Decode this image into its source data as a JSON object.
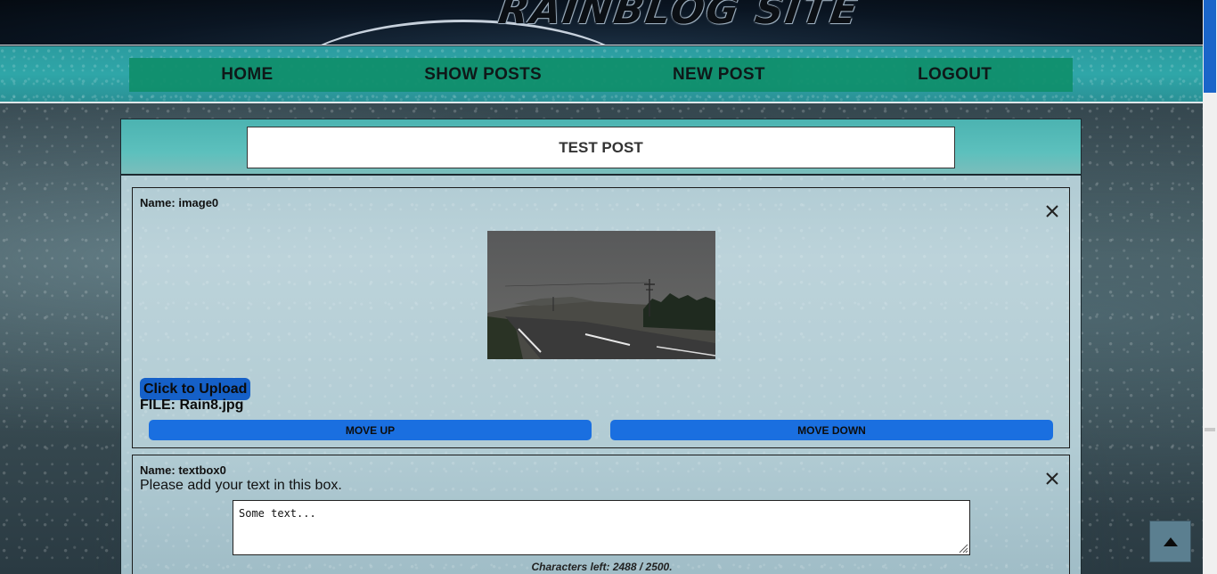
{
  "header": {
    "logo_text": "RAINBLOG SITE"
  },
  "nav": {
    "items": [
      {
        "label": "HOME"
      },
      {
        "label": "SHOW POSTS"
      },
      {
        "label": "NEW POST"
      },
      {
        "label": "LOGOUT"
      }
    ]
  },
  "post": {
    "title": "TEST POST"
  },
  "image_block": {
    "name_label": "Name: image0",
    "upload_label": "Click to Upload",
    "file_label": "FILE: Rain8.jpg",
    "move_up_label": "MOVE UP",
    "move_down_label": "MOVE DOWN"
  },
  "text_block": {
    "name_label": "Name: textbox0",
    "hint": "Please add your text in this box.",
    "content": "Some text...",
    "char_count": "Characters left: 2488 / 2500."
  },
  "icons": {
    "close": "close-icon",
    "scroll_top": "arrow-up-icon"
  },
  "colors": {
    "nav_bar": "#0f8f6b",
    "button_blue": "#1a6fe0",
    "upload_blue": "#1560c8",
    "title_band": "#4cb3b1"
  }
}
